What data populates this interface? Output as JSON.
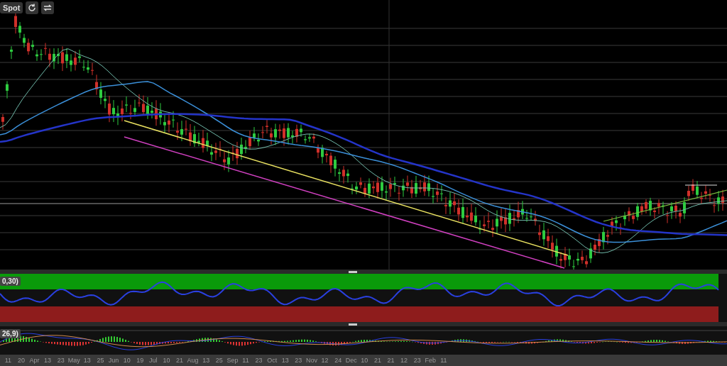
{
  "toolbar": {
    "label": "Spot"
  },
  "indicators": [
    {
      "label": "0,30)"
    },
    {
      "label": "26,9)"
    }
  ],
  "x_axis": {
    "labels": [
      "11",
      "20",
      "Apr",
      "13",
      "23",
      "May",
      "13",
      "25",
      "Jun",
      "10",
      "19",
      "Jul",
      "10",
      "21",
      "Aug",
      "13",
      "25",
      "Sep",
      "11",
      "23",
      "Oct",
      "13",
      "23",
      "Nov",
      "12",
      "24",
      "Dec",
      "10",
      "21",
      "21",
      "12",
      "23",
      "Feb",
      "11"
    ]
  }
}
